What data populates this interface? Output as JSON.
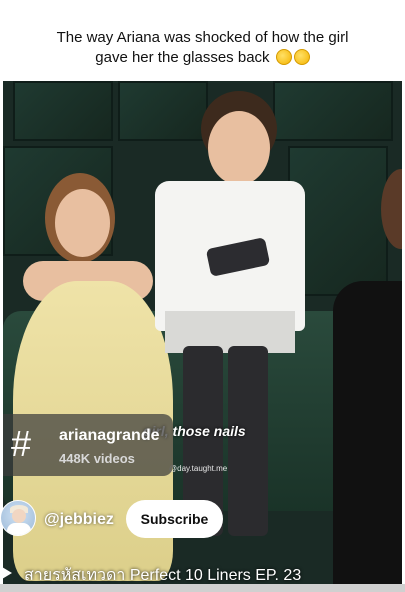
{
  "caption": {
    "line1": "The way Ariana was shocked of how the girl",
    "line2": "gave her the glasses back"
  },
  "video": {
    "subtitle": "girl, those nails",
    "watermark": "@day.taught.me"
  },
  "hashtag": {
    "icon": "hashtag-icon",
    "symbol": "#",
    "name": "arianagrande",
    "count": "448K videos"
  },
  "channel": {
    "handle": "@jebbiez",
    "subscribe_label": "Subscribe"
  },
  "title": {
    "text": "สายรหัสเทวดา Perfect 10 Liners EP. 23"
  },
  "progress": {
    "fraction": 0.0
  },
  "colors": {
    "subscribe_bg": "#ffffff",
    "overlay": "#3c3c3c"
  }
}
